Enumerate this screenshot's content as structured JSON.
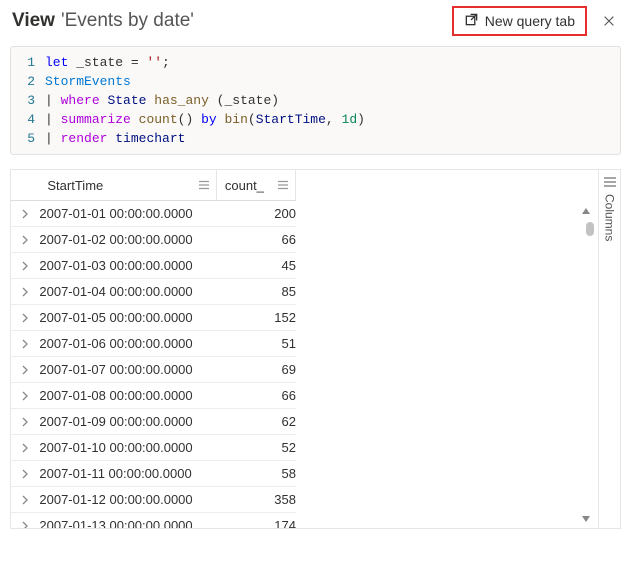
{
  "header": {
    "view_label": "View",
    "view_name": "'Events by date'",
    "new_query_label": "New query tab"
  },
  "code": {
    "lines": [
      {
        "n": 1,
        "html": "<span class='kw-blue'>let</span> _state = <span class='kw-str'>''</span>;"
      },
      {
        "n": 2,
        "html": "<span class='kw-table'>StormEvents</span>"
      },
      {
        "n": 3,
        "html": "| <span class='kw-op'>where</span> <span class='kw-col'>State</span> <span class='kw-func'>has_any</span> (_state)"
      },
      {
        "n": 4,
        "html": "| <span class='kw-op'>summarize</span> <span class='kw-func'>count</span>() <span class='kw-blue'>by</span> <span class='kw-func'>bin</span>(<span class='kw-col'>StartTime</span>, <span class='kw-lit'>1d</span>)"
      },
      {
        "n": 5,
        "html": "| <span class='kw-op'>render</span> <span class='kw-col'>timechart</span>"
      }
    ]
  },
  "table": {
    "columns": [
      "StartTime",
      "count_"
    ],
    "rows": [
      {
        "start": "2007-01-01 00:00:00.0000",
        "count": 200
      },
      {
        "start": "2007-01-02 00:00:00.0000",
        "count": 66
      },
      {
        "start": "2007-01-03 00:00:00.0000",
        "count": 45
      },
      {
        "start": "2007-01-04 00:00:00.0000",
        "count": 85
      },
      {
        "start": "2007-01-05 00:00:00.0000",
        "count": 152
      },
      {
        "start": "2007-01-06 00:00:00.0000",
        "count": 51
      },
      {
        "start": "2007-01-07 00:00:00.0000",
        "count": 69
      },
      {
        "start": "2007-01-08 00:00:00.0000",
        "count": 66
      },
      {
        "start": "2007-01-09 00:00:00.0000",
        "count": 62
      },
      {
        "start": "2007-01-10 00:00:00.0000",
        "count": 52
      },
      {
        "start": "2007-01-11 00:00:00.0000",
        "count": 58
      },
      {
        "start": "2007-01-12 00:00:00.0000",
        "count": 358
      },
      {
        "start": "2007-01-13 00:00:00.0000",
        "count": 174
      }
    ]
  },
  "side": {
    "columns_label": "Columns"
  }
}
